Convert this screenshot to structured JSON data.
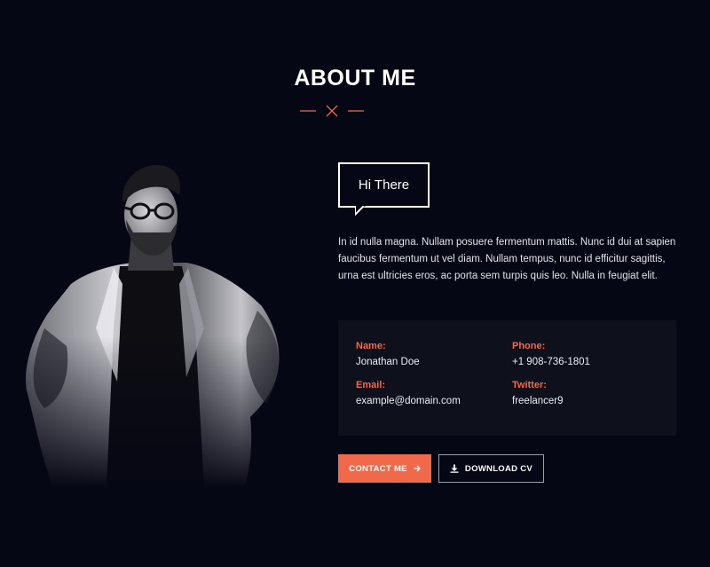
{
  "section": {
    "title": "ABOUT ME"
  },
  "about": {
    "bubble_text": "Hi There",
    "bio": "In id nulla magna. Nullam posuere fermentum mattis. Nunc id dui at sapien faucibus fermentum ut vel diam. Nullam tempus, nunc id efficitur sagittis, urna est ultricies eros, ac porta sem turpis quis leo. Nulla in feugiat elit."
  },
  "info": {
    "name_label": "Name:",
    "name_value": "Jonathan Doe",
    "phone_label": "Phone:",
    "phone_value": "+1 908-736-1801",
    "email_label": "Email:",
    "email_value": "example@domain.com",
    "twitter_label": "Twitter:",
    "twitter_value": "freelancer9"
  },
  "buttons": {
    "contact_label": "CONTACT ME",
    "download_label": "DOWNLOAD CV"
  },
  "colors": {
    "background": "#060714",
    "accent": "#f0694a",
    "card": "#0e101c"
  },
  "icons": {
    "divider": "x-mark-icon",
    "contact": "arrow-right-icon",
    "download": "download-icon"
  }
}
